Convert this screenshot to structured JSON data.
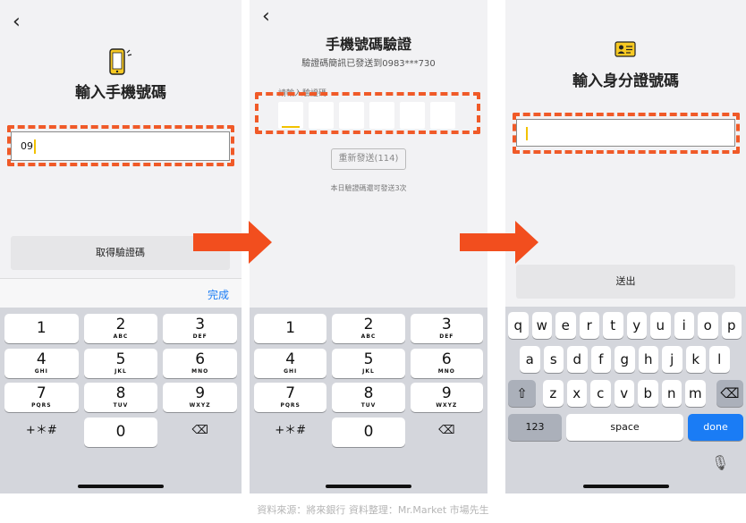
{
  "screen1": {
    "back": "‹",
    "title": "輸入手機號碼",
    "phone_value": "09",
    "get_code_button": "取得驗證碼",
    "done_label": "完成"
  },
  "screen2": {
    "back": "‹",
    "title": "手機號碼驗證",
    "subtitle": "驗證碼簡訊已發送到0983***730",
    "otp_label": "請輸入驗證碼",
    "resend_button": "重新發送(114)",
    "note": "本日驗證碼還可發送3次"
  },
  "screen3": {
    "title": "輸入身分證號碼",
    "submit_button": "送出"
  },
  "numpad": {
    "keys": [
      {
        "d": "1",
        "l": ""
      },
      {
        "d": "2",
        "l": "ABC"
      },
      {
        "d": "3",
        "l": "DEF"
      },
      {
        "d": "4",
        "l": "GHI"
      },
      {
        "d": "5",
        "l": "JKL"
      },
      {
        "d": "6",
        "l": "MNO"
      },
      {
        "d": "7",
        "l": "PQRS"
      },
      {
        "d": "8",
        "l": "TUV"
      },
      {
        "d": "9",
        "l": "WXYZ"
      },
      {
        "d": "+＊#",
        "l": ""
      },
      {
        "d": "0",
        "l": ""
      },
      {
        "d": "⌫",
        "l": ""
      }
    ]
  },
  "keyboard": {
    "row1": [
      "q",
      "w",
      "e",
      "r",
      "t",
      "y",
      "u",
      "i",
      "o",
      "p"
    ],
    "row2": [
      "a",
      "s",
      "d",
      "f",
      "g",
      "h",
      "j",
      "k",
      "l"
    ],
    "row3": [
      "z",
      "x",
      "c",
      "v",
      "b",
      "n",
      "m"
    ],
    "shift": "⇧",
    "delete": "⌫",
    "num": "123",
    "space": "space",
    "done": "done",
    "mic": "🎙"
  },
  "caption": "資料來源：將來銀行  資料整理：Mr.Market 市場先生",
  "colors": {
    "accent": "#f05a28",
    "caret": "#f2c200",
    "done_blue": "#1a7cf5"
  }
}
